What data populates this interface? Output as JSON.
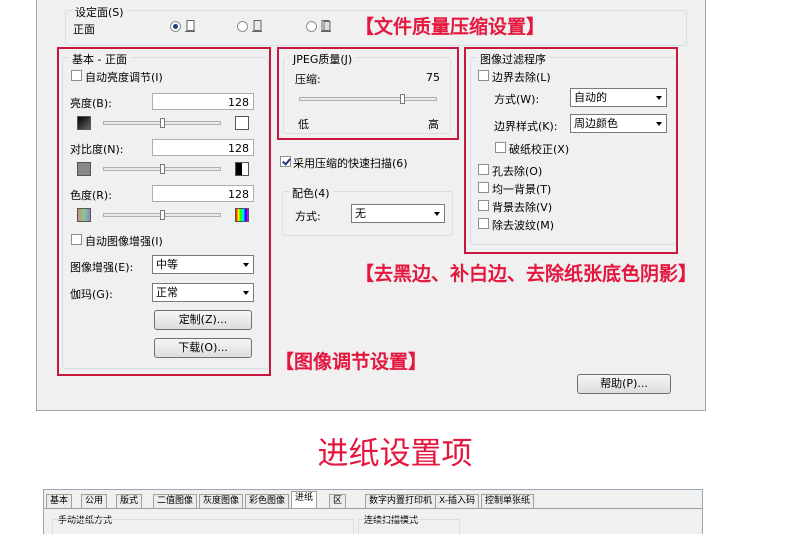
{
  "setting_side": {
    "label": "设定面(S)",
    "value": "正面"
  },
  "basic": {
    "title": "基本 - 正面",
    "auto_brightness": "自动亮度调节(I)",
    "brightness_label": "亮度(B):",
    "brightness_value": "128",
    "brightness_level": 0.5,
    "contrast_label": "对比度(N):",
    "contrast_value": "128",
    "contrast_level": 0.5,
    "hue_label": "色度(R):",
    "hue_value": "128",
    "hue_level": 0.5,
    "auto_enhance": "自动图像增强(I)",
    "enhance_label": "图像增强(E):",
    "enhance_value": "中等",
    "gamma_label": "伽玛(G):",
    "gamma_value": "正常",
    "custom_button": "定制(Z)...",
    "download_button": "下载(O)..."
  },
  "jpeg": {
    "title": "JPEG质量(J)",
    "compression_label": "压缩:",
    "compression_value": "75",
    "compression_level": 0.75,
    "low": "低",
    "high": "高",
    "fast_scan": "采用压缩的快速扫描(6)"
  },
  "color_drop": {
    "title": "配色(4)",
    "method_label": "方式:",
    "method_value": "无"
  },
  "filter": {
    "title": "图像过滤程序",
    "edge_removal": "边界去除(L)",
    "method_label": "方式(W):",
    "method_value": "自动的",
    "edge_style_label": "边界样式(K):",
    "edge_style_value": "周边颜色",
    "tear_correct": "破纸校正(X)",
    "hole_removal": "孔去除(O)",
    "uniform_bg": "均一背景(T)",
    "bg_removal": "背景去除(V)",
    "moire_removal": "除去波纹(M)"
  },
  "help_button": "帮助(P)...",
  "annotations": {
    "file_quality": "【文件质量压缩设置】",
    "edge_fill": "【去黑边、补白边、去除纸张底色阴影】",
    "image_adjust": "【图像调节设置】"
  },
  "section_heading": "进纸设置项",
  "tabs": [
    "基本",
    "公用",
    "版式",
    "二值图像",
    "灰度图像",
    "彩色图像",
    "进纸",
    "区",
    "数字内置打印机",
    "X-插入码",
    "控制单张纸"
  ],
  "active_tab": 6,
  "feed": {
    "manual_group": "手动进纸方式",
    "continuous_group": "连续扫描模式"
  },
  "colors": {
    "annotation": "#e4173f",
    "annotation_box": "#c8163d",
    "dialog_bg": "#f0f0f0"
  }
}
